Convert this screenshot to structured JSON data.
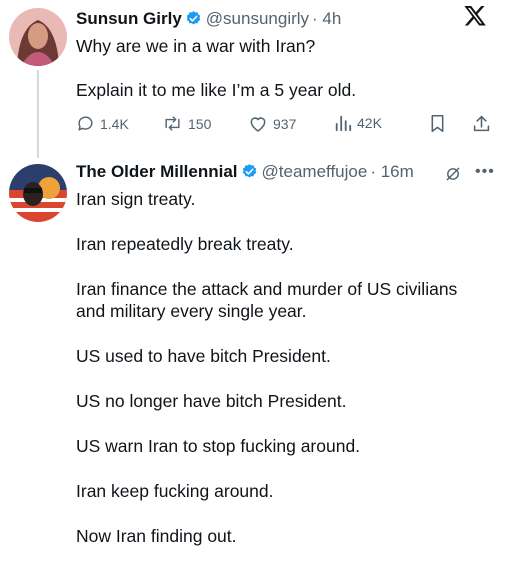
{
  "original_tweet": {
    "author_name": "Sunsun Girly",
    "handle": "@sunsungirly",
    "time": "· 4h",
    "lines": [
      "Why are we in a war with Iran?",
      "Explain it to me like I’m a 5 year old."
    ],
    "stats": {
      "replies": "1.4K",
      "reposts": "150",
      "likes": "937",
      "views": "42K"
    }
  },
  "reply_tweet": {
    "author_name": "The Older Millennial",
    "handle": "@teameffujoe",
    "time": "· 16m",
    "paragraphs": [
      "Iran sign treaty.",
      "Iran repeatedly break treaty.",
      "Iran finance the attack and murder of US civilians and military every single year.",
      "US used to have bitch President.",
      "US no longer have bitch President.",
      "US warn Iran to stop fucking around.",
      "Iran keep fucking around.",
      "Now Iran finding out."
    ]
  },
  "icons": {
    "verified": "verified-badge-icon",
    "platform": "x-logo-icon",
    "grok": "grok-icon",
    "more": "more-icon"
  },
  "colors": {
    "verified": "#1d9bf0",
    "secondary_text": "#536471",
    "primary_text": "#0f1419"
  }
}
